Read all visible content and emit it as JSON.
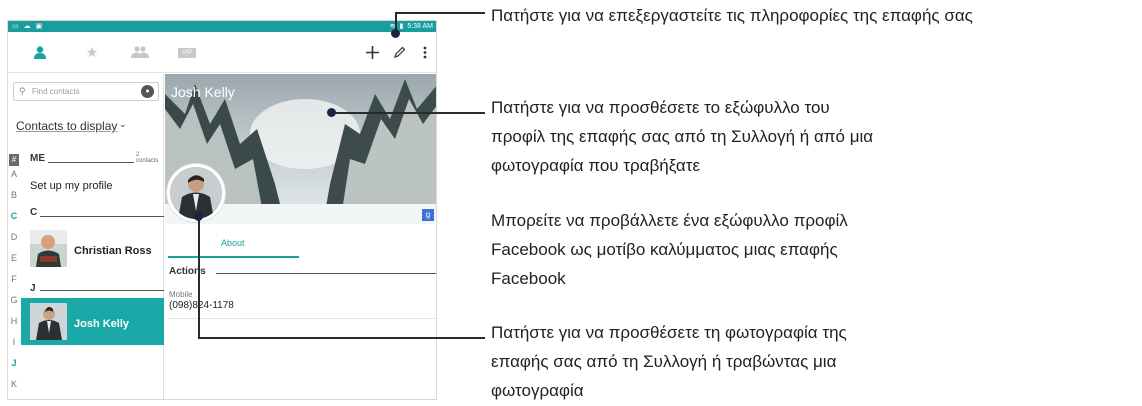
{
  "status_bar": {
    "time": "5:38 AM"
  },
  "app_bar": {
    "vip_label": "VIP"
  },
  "search": {
    "placeholder": "Find contacts"
  },
  "contacts_to_display": "Contacts to display",
  "index_letters": [
    "A",
    "B",
    "C",
    "D",
    "E",
    "F",
    "G",
    "H",
    "I",
    "J",
    "K"
  ],
  "index_highlight": [
    "C",
    "J"
  ],
  "index_hash": "#",
  "sections": {
    "me": "ME",
    "me_count": "2 contacts",
    "c": "C",
    "j": "J"
  },
  "rows": {
    "setup_profile": "Set up my profile",
    "christian": "Christian Ross",
    "josh": "Josh Kelly"
  },
  "detail": {
    "name": "Josh Kelly",
    "tab_about": "About",
    "actions_header": "Actions",
    "mobile_label": "Mobile",
    "mobile_number": "(098)824-1178",
    "gplus": "g"
  },
  "callouts": {
    "edit": "Πατήστε για να επεξεργαστείτε τις πληροφορίες της επαφής σας",
    "cover_1": "Πατήστε για να προσθέσετε το εξώφυλλο του",
    "cover_2": "προφίλ της επαφής σας από τη Συλλογή ή από μια",
    "cover_3": "φωτογραφία που τραβήξατε",
    "fb_1": "Μπορείτε να προβάλλετε ένα εξώφυλλο προφίλ",
    "fb_2": "Facebook ως μοτίβο καλύμματος μιας επαφής",
    "fb_3": "Facebook",
    "photo_1": "Πατήστε για να προσθέσετε τη φωτογραφία της",
    "photo_2": "επαφής σας από τη Συλλογή ή τραβώντας μια",
    "photo_3": "φωτογραφία"
  },
  "colors": {
    "accent": "#1aa9a6",
    "status_bar": "#1a9e9d",
    "callout_dot": "#1b2440"
  }
}
